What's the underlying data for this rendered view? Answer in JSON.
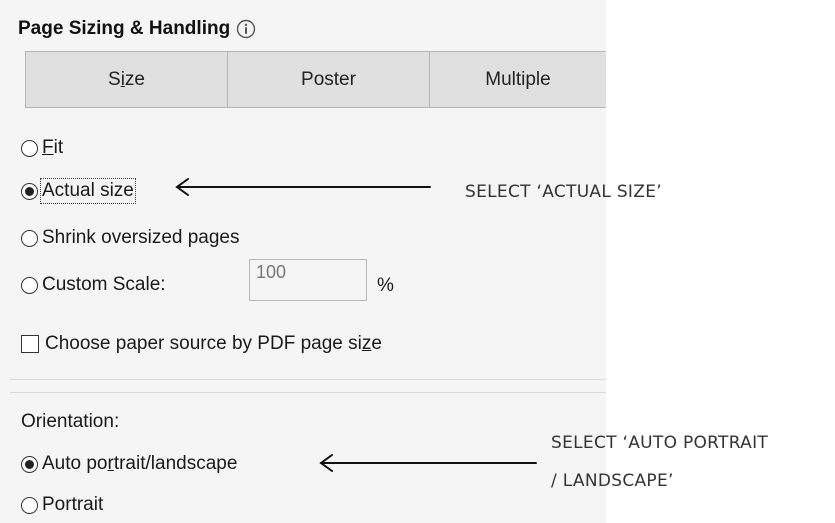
{
  "section": {
    "title": "Page Sizing & Handling",
    "info_icon": "info-icon"
  },
  "tabs": [
    {
      "label": "Size",
      "underline_char": "i"
    },
    {
      "label": "Poster"
    },
    {
      "label": "Multiple"
    }
  ],
  "sizing_options": {
    "fit": {
      "pre": "",
      "u": "F",
      "post": "it",
      "selected": false
    },
    "actual_size": {
      "label": "Actual size",
      "selected": true
    },
    "shrink": {
      "label": "Shrink oversized pages",
      "selected": false
    },
    "custom_scale": {
      "label": "Custom Scale:",
      "selected": false,
      "value": "100",
      "unit": "%"
    }
  },
  "paper_source": {
    "pre": "Choose paper source by PDF page si",
    "u": "z",
    "post": "e",
    "checked": false
  },
  "orientation": {
    "label": "Orientation:",
    "auto": {
      "pre": "Auto po",
      "u": "r",
      "post": "trait/landscape",
      "selected": true
    },
    "portrait": {
      "label": "Portrait",
      "selected": false
    }
  },
  "annotations": {
    "actual_size_note": "SELECT ‘ACTUAL SIZE’",
    "orientation_note_line1": "SELECT ‘AUTO PORTRAIT",
    "orientation_note_line2": "/ LANDSCAPE’"
  }
}
